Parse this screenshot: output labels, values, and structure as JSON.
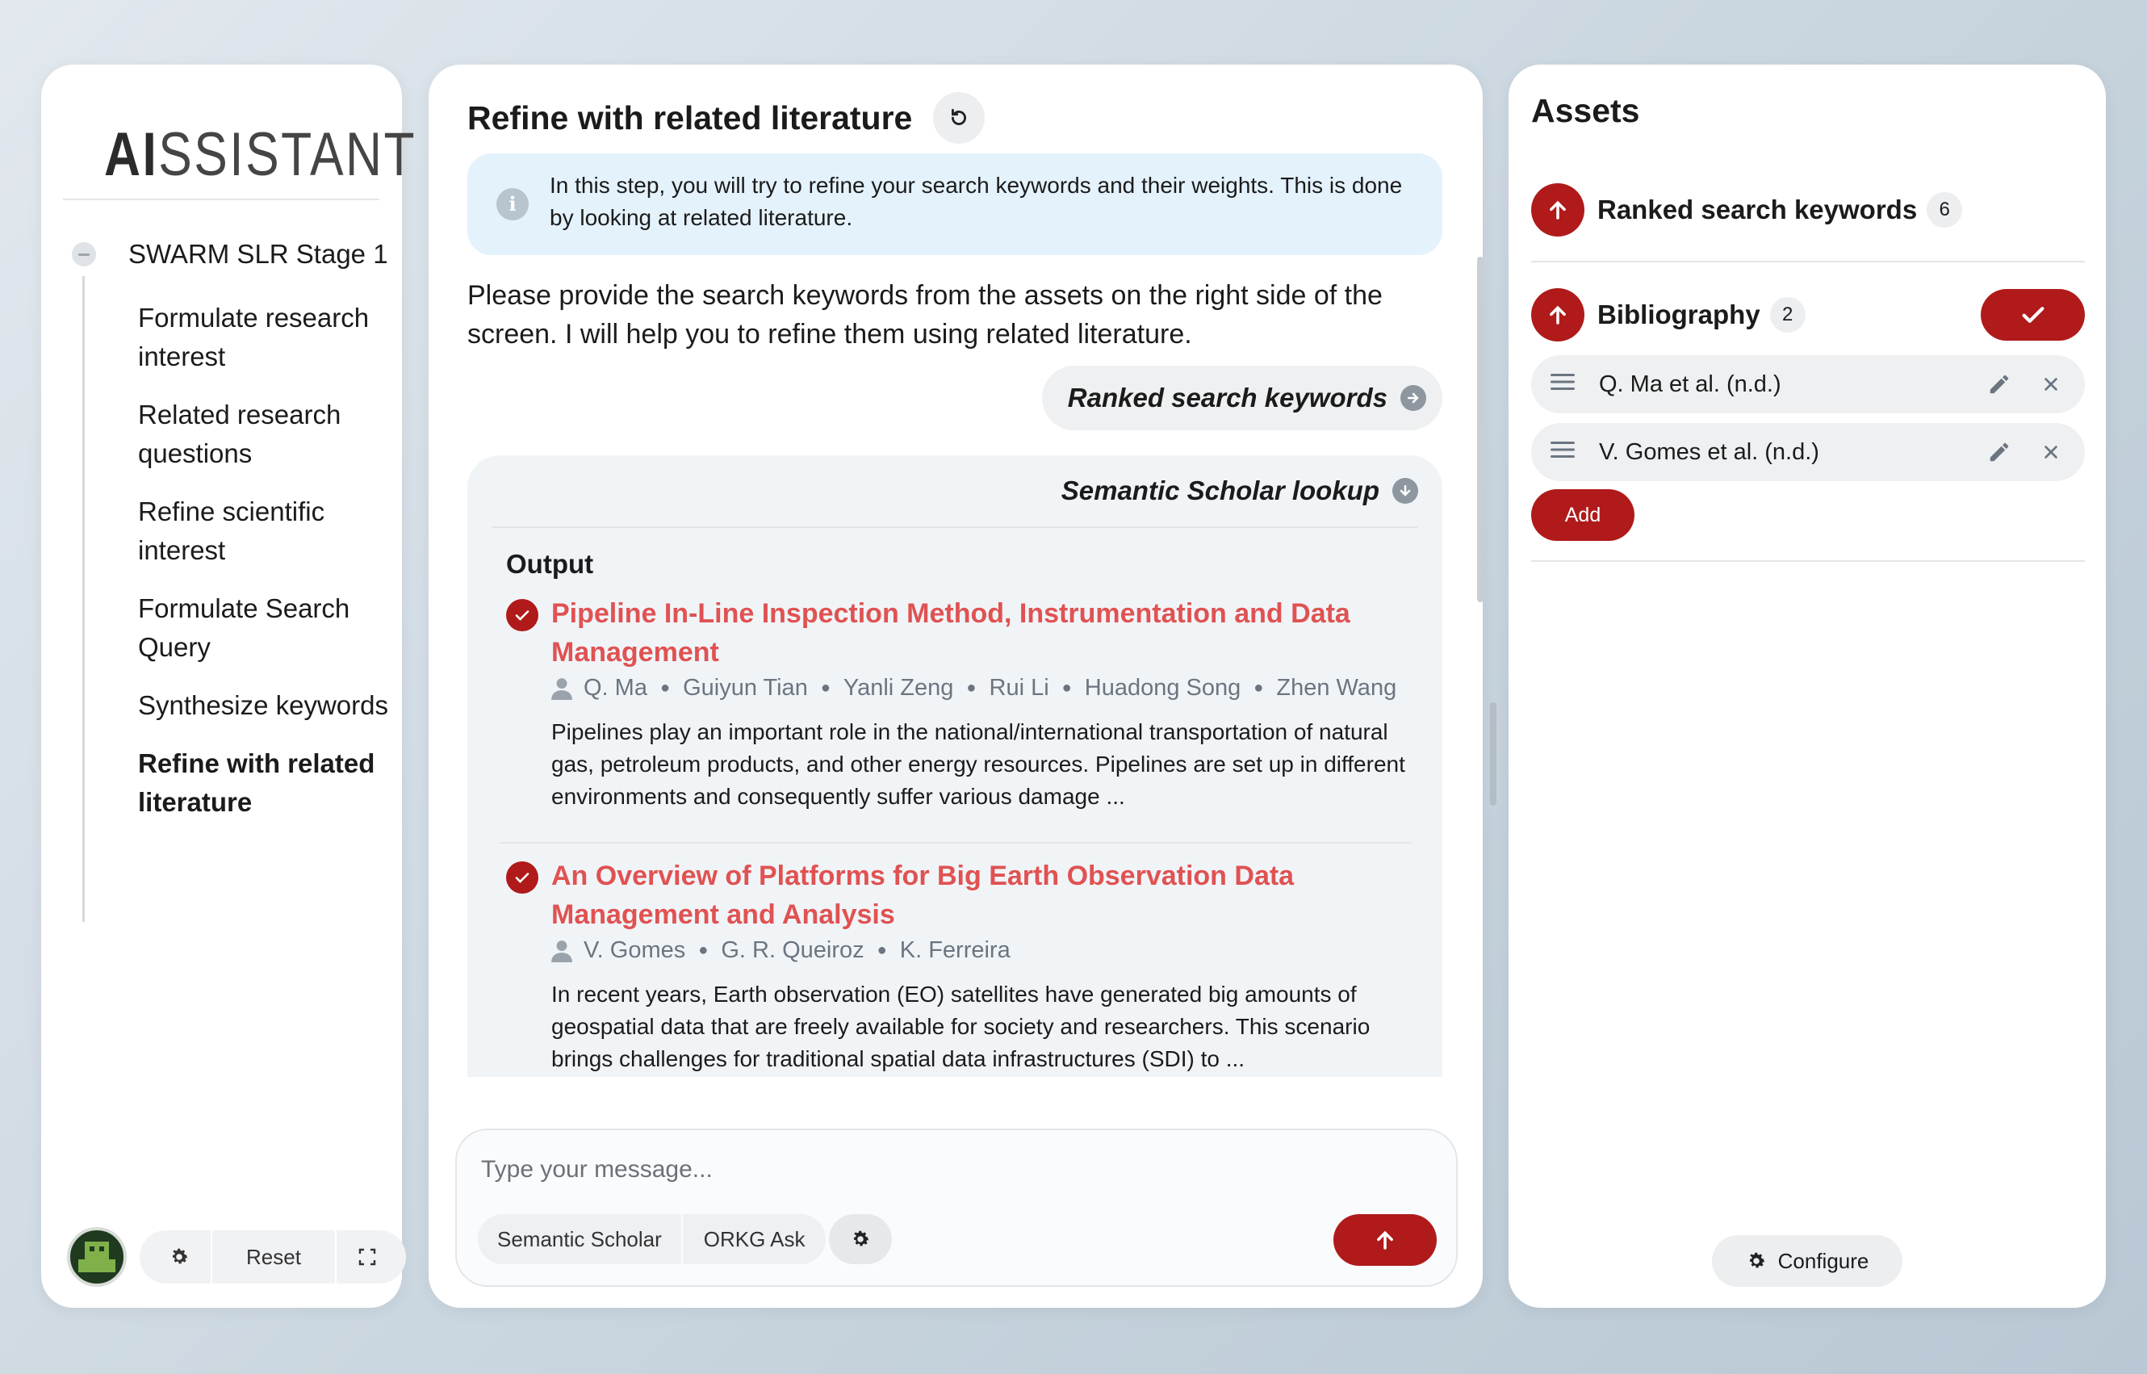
{
  "sidebar": {
    "logo_bold": "AI",
    "logo_rest": "SSISTANT",
    "stage_title": "SWARM SLR Stage 1",
    "steps": [
      "Formulate research interest",
      "Related research questions",
      "Refine scientific interest",
      "Formulate Search Query",
      "Synthesize keywords",
      "Refine with related literature"
    ],
    "active_step_index": 5,
    "footer": {
      "reset_label": "Reset"
    }
  },
  "center": {
    "title": "Refine with related literature",
    "info_text": "In this step, you will try to refine your search keywords and their weights. This is done by looking at related literature.",
    "prompt_text": "Please provide the search keywords from the assets on the right side of the screen. I will help you to refine them using related literature.",
    "reference_pill": "Ranked search keywords",
    "lookup_title": "Semantic Scholar lookup",
    "output_label": "Output",
    "results": [
      {
        "title": "Pipeline In-Line Inspection Method, Instrumentation and Data Management",
        "authors": [
          "Q. Ma",
          "Guiyun Tian",
          "Yanli Zeng",
          "Rui Li",
          "Huadong Song",
          "Zhen Wang"
        ],
        "abstract": "Pipelines play an important role in the national/international transportation of natural gas, petroleum products, and other energy resources. Pipelines are set up in different environments and consequently suffer various damage ..."
      },
      {
        "title": "An Overview of Platforms for Big Earth Observation Data Management and Analysis",
        "authors": [
          "V. Gomes",
          "G. R. Queiroz",
          "K. Ferreira"
        ],
        "abstract": "In recent years, Earth observation (EO) satellites have generated big amounts of geospatial data that are freely available for society and researchers. This scenario brings challenges for traditional spatial data infrastructures (SDI) to ..."
      }
    ],
    "composer": {
      "placeholder": "Type your message...",
      "tool_1": "Semantic Scholar",
      "tool_2": "ORKG Ask"
    }
  },
  "assets": {
    "title": "Assets",
    "ranked_label": "Ranked search keywords",
    "ranked_count": "6",
    "bibliography_label": "Bibliography",
    "bibliography_count": "2",
    "bibliography_items": [
      "Q. Ma et al. (n.d.)",
      "V. Gomes et al. (n.d.)"
    ],
    "add_label": "Add",
    "configure_label": "Configure"
  },
  "colors": {
    "accent": "#b01a1a",
    "link_title": "#e05252",
    "info_bg": "#e4f2fc",
    "muted_text": "#6b7580"
  }
}
